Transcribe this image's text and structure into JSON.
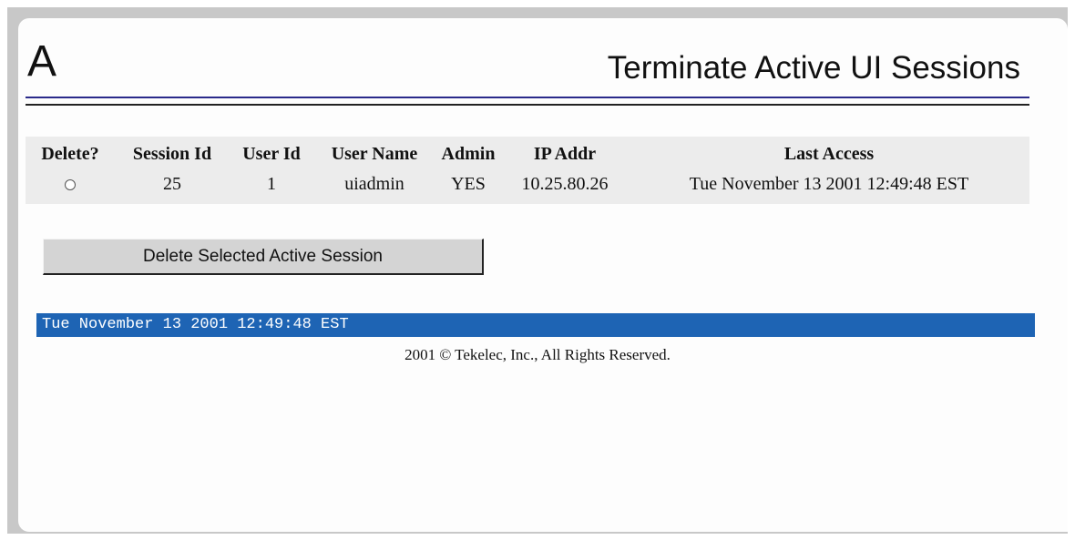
{
  "header": {
    "logo_text": "A",
    "title": "Terminate Active UI Sessions"
  },
  "table": {
    "columns": [
      "Delete?",
      "Session Id",
      "User Id",
      "User Name",
      "Admin",
      "IP Addr",
      "Last Access"
    ],
    "rows": [
      {
        "selected": false,
        "session_id": "25",
        "user_id": "1",
        "user_name": "uiadmin",
        "admin": "YES",
        "ip_addr": "10.25.80.26",
        "last_access": "Tue November 13 2001 12:49:48 EST"
      }
    ]
  },
  "actions": {
    "delete_label": "Delete Selected Active Session"
  },
  "status_bar": {
    "text": "Tue November 13 2001 12:49:48 EST"
  },
  "footer": {
    "text": "2001 © Tekelec, Inc., All Rights Reserved."
  },
  "colors": {
    "status_bar_bg": "#1e64b4",
    "rule_blue": "#2a2a8a",
    "table_bg": "#ececec"
  }
}
